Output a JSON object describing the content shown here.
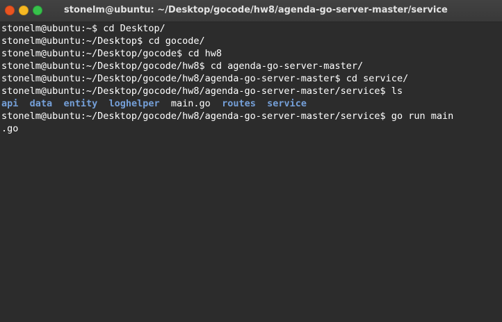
{
  "window": {
    "title": "stonelm@ubuntu: ~/Desktop/gocode/hw8/agenda-go-server-master/service",
    "controls": {
      "close_icon": "close-icon",
      "minimize_icon": "minimize-icon",
      "maximize_icon": "maximize-icon"
    }
  },
  "colors": {
    "background": "#2c2c2c",
    "directory": "#75a0d9",
    "text": "#ffffff",
    "close": "#e95420",
    "minimize": "#f6b823",
    "maximize": "#37c14b"
  },
  "terminal": {
    "lines": [
      "stonelm@ubuntu:~$ cd Desktop/",
      "stonelm@ubuntu:~/Desktop$ cd gocode/",
      "stonelm@ubuntu:~/Desktop/gocode$ cd hw8",
      "stonelm@ubuntu:~/Desktop/gocode/hw8$ cd agenda-go-server-master/",
      "stonelm@ubuntu:~/Desktop/gocode/hw8/agenda-go-server-master$ cd service/",
      "stonelm@ubuntu:~/Desktop/gocode/hw8/agenda-go-server-master/service$ ls"
    ],
    "ls_output": [
      {
        "name": "api",
        "type": "dir"
      },
      {
        "name": "data",
        "type": "dir"
      },
      {
        "name": "entity",
        "type": "dir"
      },
      {
        "name": "loghelper",
        "type": "dir"
      },
      {
        "name": "main.go",
        "type": "file"
      },
      {
        "name": "routes",
        "type": "dir"
      },
      {
        "name": "service",
        "type": "dir"
      }
    ],
    "last_command": "stonelm@ubuntu:~/Desktop/gocode/hw8/agenda-go-server-master/service$ go run main",
    "last_command_wrap": ".go"
  }
}
